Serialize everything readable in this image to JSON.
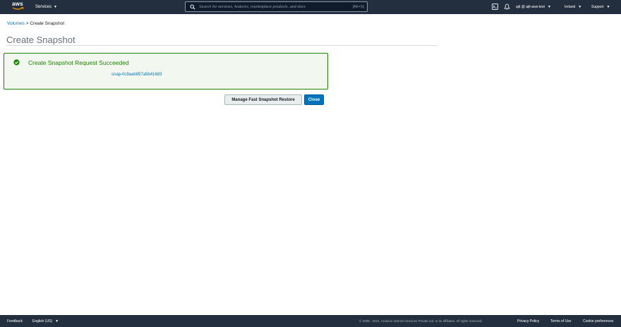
{
  "topnav": {
    "logo_text": "aws",
    "services_label": "Services",
    "search_placeholder": "Search for services, features, marketplace products, and docs",
    "search_shortcut": "[Alt+S]",
    "account_label": "ajit @ ajit-aws-test",
    "region_label": "Ireland",
    "support_label": "Support",
    "icons": [
      "cloudshell-icon",
      "bell-icon"
    ]
  },
  "breadcrumb": {
    "parent": "Volumes",
    "separator": ">",
    "current": "Create Snapshot"
  },
  "page": {
    "title": "Create Snapshot"
  },
  "success": {
    "heading": "Create Snapshot Request Succeeded",
    "snapshot_id": "snap-0c9aab857a5b41683",
    "icon": "check-circle-icon",
    "color": "#1d8102"
  },
  "actions": {
    "manage_label": "Manage Fast Snapshot Restore",
    "close_label": "Close"
  },
  "footer": {
    "feedback_label": "Feedback",
    "language_label": "English (US)",
    "copyright": "© 2008 - 2021, Amazon Internet Services Private Ltd. or its affiliates. All rights reserved.",
    "privacy_label": "Privacy Policy",
    "terms_label": "Terms of Use",
    "cookie_label": "Cookie preferences"
  },
  "colors": {
    "nav_bg": "#232f3e",
    "link": "#0073bb",
    "primary_button": "#0073bb"
  }
}
